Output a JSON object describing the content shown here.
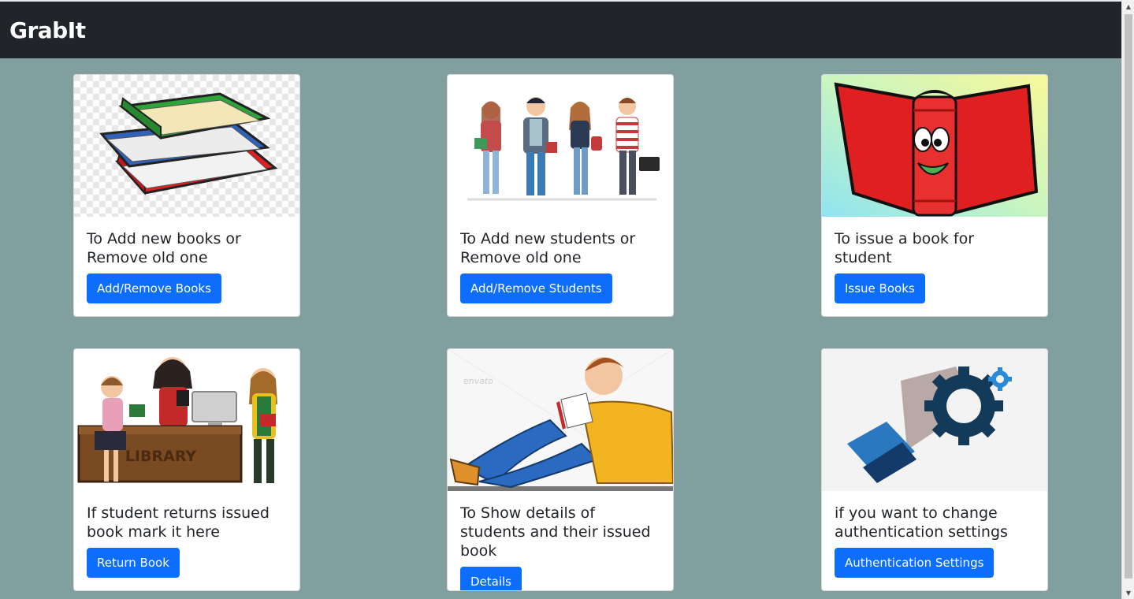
{
  "navbar": {
    "brand": "GrabIt"
  },
  "cards": [
    {
      "title": "To Add new books or Remove old one",
      "button": "Add/Remove Books"
    },
    {
      "title": "To Add new students or Remove old one",
      "button": "Add/Remove Students"
    },
    {
      "title": "To issue a book for student",
      "button": "Issue Books"
    },
    {
      "title": "If student returns issued book mark it here",
      "button": "Return Book"
    },
    {
      "title": "To Show details of students and their issued book",
      "button": "Details"
    },
    {
      "title": "if you want to change authentication settings",
      "button": "Authentication Settings"
    }
  ],
  "images": {
    "library_sign": "LIBRARY",
    "watermark": "envato"
  },
  "colors": {
    "navbar": "#212529",
    "page_background": "#829fa0",
    "button": "#0d6efd"
  }
}
